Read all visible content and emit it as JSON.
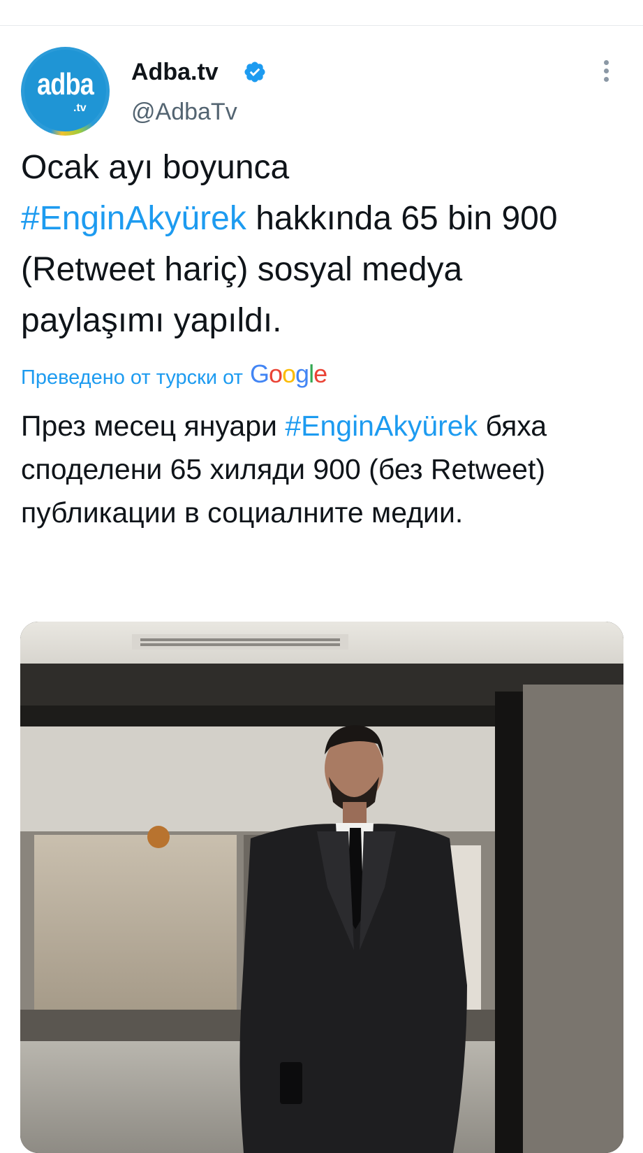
{
  "author": {
    "avatar_text": "adba",
    "avatar_sub": ".tv",
    "display_name": "Adba.tv",
    "handle": "@AdbaTv",
    "verified": true
  },
  "icons": {
    "verified": "verified-badge-icon",
    "more": "more-vertical-icon"
  },
  "tweet": {
    "line1": "Ocak ayı boyunca",
    "hashtag": "#EnginAkyürek",
    "text_after_hashtag": " hakkında 65 bin 900 (Retweet hariç) sosyal medya paylaşımı yapıldı."
  },
  "translation": {
    "label": "Преведено от турски от ",
    "provider_letters": [
      "G",
      "o",
      "o",
      "g",
      "l",
      "e"
    ],
    "text_before": "През месец януари ",
    "hashtag": "#EnginAkyürek",
    "text_after": " бяха споделени 65 хиляди 900 (без Retweet) публикации в социалните медии."
  },
  "colors": {
    "accent": "#1d9bf0",
    "text": "#0f1419",
    "secondary": "#536471"
  }
}
